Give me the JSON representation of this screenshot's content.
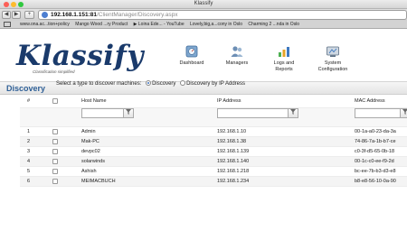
{
  "window": {
    "title": "Klassify"
  },
  "browser": {
    "nav": {
      "back": "◀",
      "forward": "▶",
      "add": "+"
    },
    "url": {
      "host": "192.168.1.151:81",
      "path": "/ClientManager/Discovery.aspx"
    },
    "bookmarks": [
      "www.ona.ac...tion+policy",
      "Mango Wood ...ry Product",
      "▶ Loina Ede... - YouTube",
      "Lovely,big,a...cony in Oslo",
      "Charming 2 ...nda in Oslo"
    ]
  },
  "app": {
    "logo": "Klassify",
    "logo_tagline": "Classification simplified",
    "nav": [
      {
        "label": "Dashboard",
        "icon": "dashboard-icon"
      },
      {
        "label": "Managers",
        "icon": "managers-icon"
      },
      {
        "label": "Logs and Reports",
        "icon": "logs-reports-icon"
      },
      {
        "label": "System Configuration",
        "icon": "system-configuration-icon"
      }
    ]
  },
  "page": {
    "title": "Discovery",
    "filter": {
      "prompt": "Select a type to discover machines:",
      "options": [
        "Discovery",
        "Discovery by IP Address"
      ],
      "selected": "Discovery"
    }
  },
  "table": {
    "columns": [
      "#",
      "",
      "Host Name",
      "IP Address",
      "MAC Address"
    ],
    "filter_icon": "funnel-icon",
    "rows": [
      {
        "num": "1",
        "host": "Admin",
        "ip": "192.168.1.10",
        "mac": "00-1a-a0-23-da-3a"
      },
      {
        "num": "2",
        "host": "Mak-PC",
        "ip": "192.168.1.38",
        "mac": "74-86-7a-1b-b7-ce"
      },
      {
        "num": "3",
        "host": "devpc02",
        "ip": "192.168.1.139",
        "mac": "c0-3f-d5-65-0b-18"
      },
      {
        "num": "4",
        "host": "solarwinds",
        "ip": "192.168.1.140",
        "mac": "00-1c-c0-ee-f9-2d"
      },
      {
        "num": "5",
        "host": "Ashish",
        "ip": "192.168.1.218",
        "mac": "bc-ee-7b-b3-d3-e8"
      },
      {
        "num": "6",
        "host": "MEIMACBUCH",
        "ip": "192.168.1.234",
        "mac": "b8-e8-56-10-0a-90"
      }
    ]
  },
  "colors": {
    "accent": "#2e5f96",
    "logo": "#1a3a6b"
  }
}
